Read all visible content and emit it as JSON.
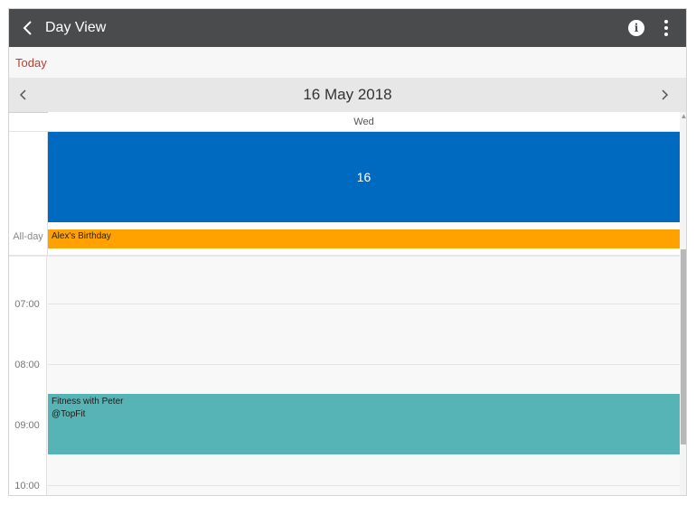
{
  "titlebar": {
    "title": "Day View",
    "back_icon": "chevron-left-icon",
    "info_icon": "info-icon",
    "info_glyph": "i",
    "more_icon": "more-vertical-icon",
    "background": "#4a4b4d"
  },
  "toolbar": {
    "today_label": "Today",
    "today_color": "#c0392b"
  },
  "navigator": {
    "date_title": "16 May 2018",
    "prev_icon": "chevron-left-icon",
    "next_icon": "chevron-right-icon"
  },
  "day": {
    "name": "Wed",
    "number": "16",
    "color": "#0069c0"
  },
  "allday": {
    "label": "All-day",
    "event": {
      "title": "Alex's Birthday",
      "color": "#ffa200"
    }
  },
  "timeslots": [
    "07:00",
    "08:00",
    "09:00",
    "10:00"
  ],
  "events": [
    {
      "title": "Fitness with Peter",
      "location": "@TopFit",
      "color": "#57b4b6"
    }
  ]
}
